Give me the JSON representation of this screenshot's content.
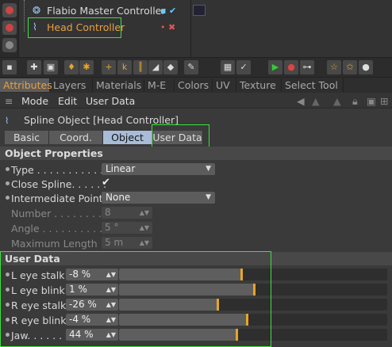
{
  "object_manager": {
    "rows": [
      {
        "name": "Flabio Master Controller",
        "tags": "▪ ✔"
      },
      {
        "name": "Head Controller",
        "tags": "• ✖"
      }
    ]
  },
  "tabs": [
    "Attributes",
    "Layers",
    "Materials",
    "M-E",
    "Colors",
    "UV",
    "Texture",
    "Select Tool"
  ],
  "active_tab": "Attributes",
  "menu": [
    "Mode",
    "Edit",
    "User Data"
  ],
  "object_title": "Spline Object [Head Controller]",
  "subtabs": [
    "Basic",
    "Coord.",
    "Object",
    "User Data"
  ],
  "object_properties": {
    "header": "Object Properties",
    "type": {
      "label": "Type . . . . . . . . . . . .",
      "value": "Linear"
    },
    "close_spline": {
      "label": "Close Spline. . . . . .",
      "value": "✔"
    },
    "intermediate": {
      "label": "Intermediate Points",
      "value": "None"
    },
    "number": {
      "label": "Number . . . . . . . . . .",
      "value": "8"
    },
    "angle": {
      "label": "Angle . . . . . . . . . . .",
      "value": "5 °"
    },
    "max_length": {
      "label": "Maximum Length",
      "value": "5 m"
    }
  },
  "user_data": {
    "header": "User Data",
    "items": [
      {
        "label": "L eye stalk",
        "value": "-8 %",
        "level": 0.46
      },
      {
        "label": "L eye blink",
        "value": "1 %",
        "level": 0.505
      },
      {
        "label": "R eye stalk",
        "value": "-26 %",
        "level": 0.37
      },
      {
        "label": "R eye blink",
        "value": "-4 %",
        "level": 0.48
      },
      {
        "label": "Jaw. . . . . .",
        "value": "44 %",
        "level": 0.44
      }
    ]
  },
  "colors": {
    "accent": "#e8a528",
    "active_tab_text": "#e8a040",
    "highlight": "#3be13b"
  }
}
